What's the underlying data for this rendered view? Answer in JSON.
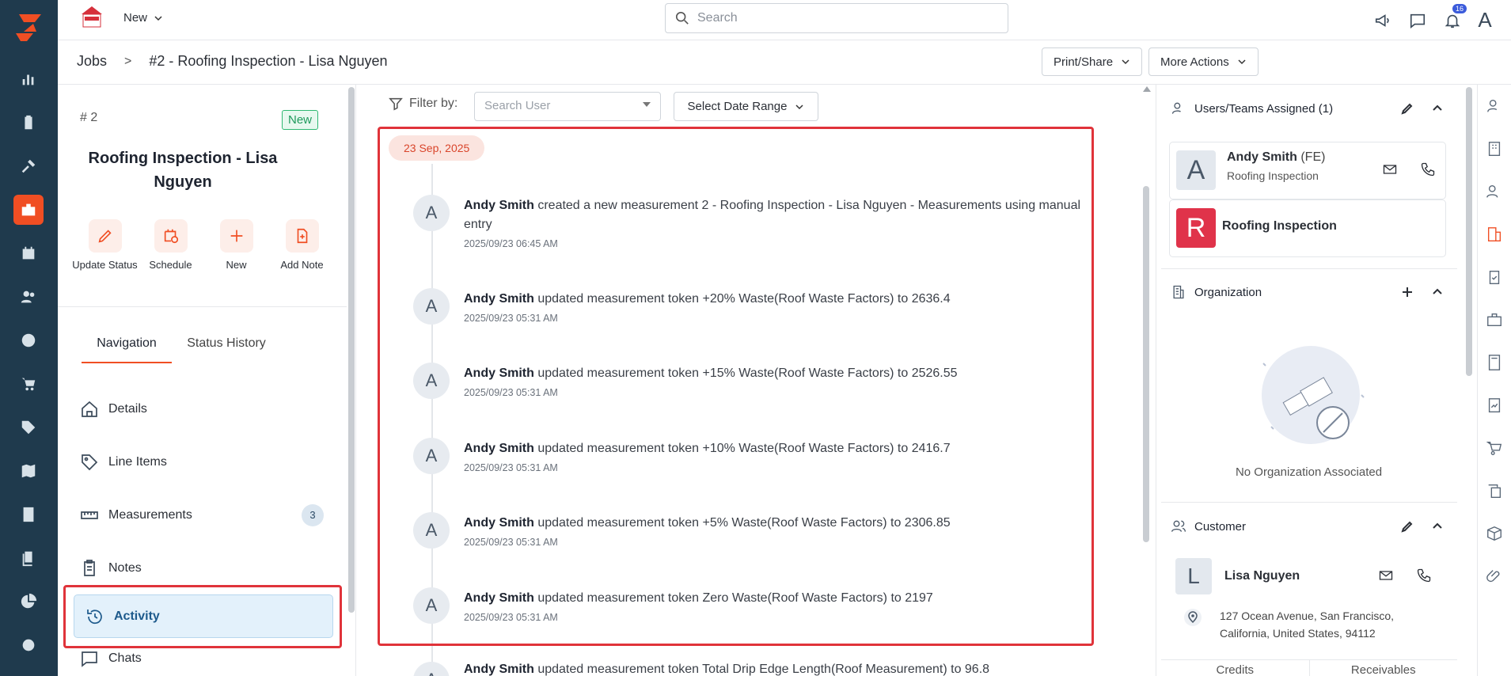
{
  "topbar": {
    "new_label": "New",
    "search_placeholder": "Search",
    "notification_count": "16",
    "user_initial": "A"
  },
  "breadcrumb": {
    "root": "Jobs",
    "separator": ">",
    "current": "#2 - Roofing Inspection - Lisa Nguyen"
  },
  "header_actions": {
    "print_share": "Print/Share",
    "more_actions": "More Actions"
  },
  "job": {
    "number": "# 2",
    "status": "New",
    "title": "Roofing Inspection - Lisa Nguyen",
    "actions": [
      {
        "label": "Update Status",
        "icon": "pencil-icon"
      },
      {
        "label": "Schedule",
        "icon": "calendar-clock-icon"
      },
      {
        "label": "New",
        "icon": "plus-icon"
      },
      {
        "label": "Add Note",
        "icon": "note-add-icon"
      }
    ]
  },
  "panel_tabs": {
    "navigation": "Navigation",
    "status_history": "Status History"
  },
  "nav": {
    "details": "Details",
    "line_items": "Line Items",
    "measurements": "Measurements",
    "measurements_count": "3",
    "notes": "Notes",
    "activity": "Activity",
    "chats": "Chats"
  },
  "activity": {
    "filter_label": "Filter by:",
    "user_placeholder": "Search User",
    "date_range": "Select Date Range",
    "date_chip": "23 Sep, 2025",
    "entries": [
      {
        "user": "Andy Smith",
        "text": " created a new measurement 2 - Roofing Inspection - Lisa Nguyen - Measurements using manual entry",
        "time": "2025/09/23 06:45 AM"
      },
      {
        "user": "Andy Smith",
        "text": " updated measurement token +20% Waste(Roof Waste Factors) to 2636.4",
        "time": "2025/09/23 05:31 AM"
      },
      {
        "user": "Andy Smith",
        "text": " updated measurement token +15% Waste(Roof Waste Factors) to 2526.55",
        "time": "2025/09/23 05:31 AM"
      },
      {
        "user": "Andy Smith",
        "text": " updated measurement token +10% Waste(Roof Waste Factors) to 2416.7",
        "time": "2025/09/23 05:31 AM"
      },
      {
        "user": "Andy Smith",
        "text": " updated measurement token +5% Waste(Roof Waste Factors) to 2306.85",
        "time": "2025/09/23 05:31 AM"
      },
      {
        "user": "Andy Smith",
        "text": " updated measurement token Zero Waste(Roof Waste Factors) to 2197",
        "time": "2025/09/23 05:31 AM"
      },
      {
        "user": "Andy Smith",
        "text": " updated measurement token Total Drip Edge Length(Roof Measurement) to 96.8",
        "time": ""
      }
    ],
    "avatar_initial": "A"
  },
  "right": {
    "assigned_title": "Users/Teams Assigned (1)",
    "assigned_user": "Andy Smith",
    "assigned_role": "(FE)",
    "assigned_sub": "Roofing Inspection",
    "assigned_user_initial": "A",
    "team_name": "Roofing Inspection",
    "team_initial": "R",
    "org_title": "Organization",
    "no_org": "No Organization Associated",
    "customer_title": "Customer",
    "customer_initial": "L",
    "customer_name": "Lisa Nguyen",
    "customer_address": "127 Ocean Avenue, San Francisco, California, United States, 94112",
    "tab_credits": "Credits",
    "tab_receivables": "Receivables"
  },
  "colors": {
    "brand": "#f04e23",
    "rail": "#1f3a4d",
    "highlight": "#e0333a"
  }
}
